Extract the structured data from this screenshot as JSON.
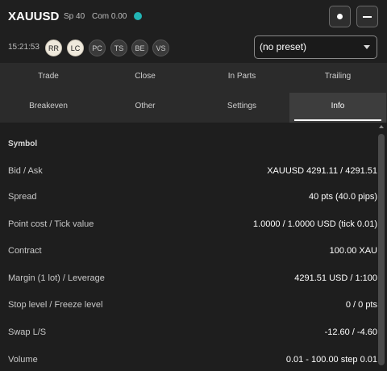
{
  "header": {
    "title": "XAUUSD",
    "spread_stat": "Sp 40",
    "commission_stat": "Com 0.00",
    "status_color": "#22b5b5",
    "buttons": [
      {
        "icon": "dot-icon"
      },
      {
        "icon": "minimize-icon"
      }
    ]
  },
  "toolbar": {
    "time": "15:21:53",
    "chips": [
      {
        "label": "RR",
        "active": true
      },
      {
        "label": "LC",
        "active": true
      },
      {
        "label": "PC",
        "active": false
      },
      {
        "label": "TS",
        "active": false
      },
      {
        "label": "BE",
        "active": false
      },
      {
        "label": "VS",
        "active": false
      }
    ],
    "preset": "(no preset)"
  },
  "tabs": [
    {
      "label": "Trade"
    },
    {
      "label": "Close"
    },
    {
      "label": "In Parts"
    },
    {
      "label": "Trailing"
    },
    {
      "label": "Breakeven"
    },
    {
      "label": "Other"
    },
    {
      "label": "Settings"
    },
    {
      "label": "Info",
      "active": true
    }
  ],
  "info": {
    "section_title": "Symbol",
    "rows": [
      {
        "label": "Bid / Ask",
        "value": "XAUUSD  4291.11 / 4291.51"
      },
      {
        "label": "Spread",
        "value": "40 pts (40.0 pips)"
      },
      {
        "label": "Point cost / Tick value",
        "value": "1.0000 / 1.0000 USD (tick 0.01)"
      },
      {
        "label": "Contract",
        "value": "100.00 XAU"
      },
      {
        "label": "Margin (1 lot) / Leverage",
        "value": "4291.51 USD / 1:100"
      },
      {
        "label": "Stop level / Freeze level",
        "value": "0 / 0 pts"
      },
      {
        "label": "Swap L/S",
        "value": "-12.60 / -4.60"
      },
      {
        "label": "Volume",
        "value": "0.01 - 100.00 step 0.01"
      }
    ]
  }
}
